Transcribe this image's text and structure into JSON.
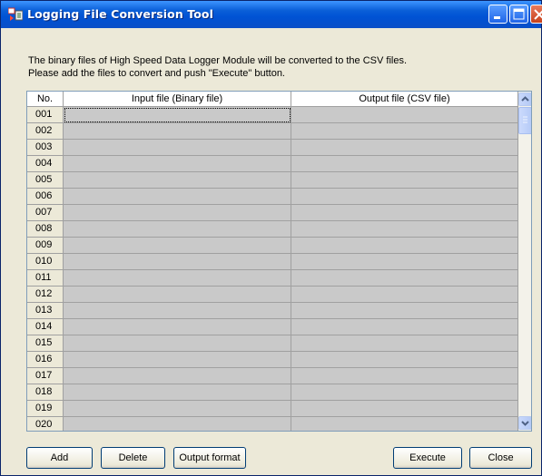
{
  "window": {
    "title": "Logging File Conversion Tool"
  },
  "description": {
    "line1": "The binary files of High Speed Data Logger Module will be converted to the CSV files.",
    "line2": "Please add the files to convert and push \"Execute\" button."
  },
  "grid": {
    "columns": [
      "No.",
      "Input file (Binary file)",
      "Output file (CSV file)"
    ],
    "rows": [
      {
        "no": "001",
        "input": "",
        "output": ""
      },
      {
        "no": "002",
        "input": "",
        "output": ""
      },
      {
        "no": "003",
        "input": "",
        "output": ""
      },
      {
        "no": "004",
        "input": "",
        "output": ""
      },
      {
        "no": "005",
        "input": "",
        "output": ""
      },
      {
        "no": "006",
        "input": "",
        "output": ""
      },
      {
        "no": "007",
        "input": "",
        "output": ""
      },
      {
        "no": "008",
        "input": "",
        "output": ""
      },
      {
        "no": "009",
        "input": "",
        "output": ""
      },
      {
        "no": "010",
        "input": "",
        "output": ""
      },
      {
        "no": "011",
        "input": "",
        "output": ""
      },
      {
        "no": "012",
        "input": "",
        "output": ""
      },
      {
        "no": "013",
        "input": "",
        "output": ""
      },
      {
        "no": "014",
        "input": "",
        "output": ""
      },
      {
        "no": "015",
        "input": "",
        "output": ""
      },
      {
        "no": "016",
        "input": "",
        "output": ""
      },
      {
        "no": "017",
        "input": "",
        "output": ""
      },
      {
        "no": "018",
        "input": "",
        "output": ""
      },
      {
        "no": "019",
        "input": "",
        "output": ""
      },
      {
        "no": "020",
        "input": "",
        "output": ""
      }
    ]
  },
  "buttons": {
    "add": "Add",
    "delete": "Delete",
    "output_format": "Output format",
    "execute": "Execute",
    "close": "Close"
  },
  "colors": {
    "titlebar": "#0a5fd8",
    "cell_background": "#c9c9c9",
    "window_background": "#ece9d8"
  }
}
